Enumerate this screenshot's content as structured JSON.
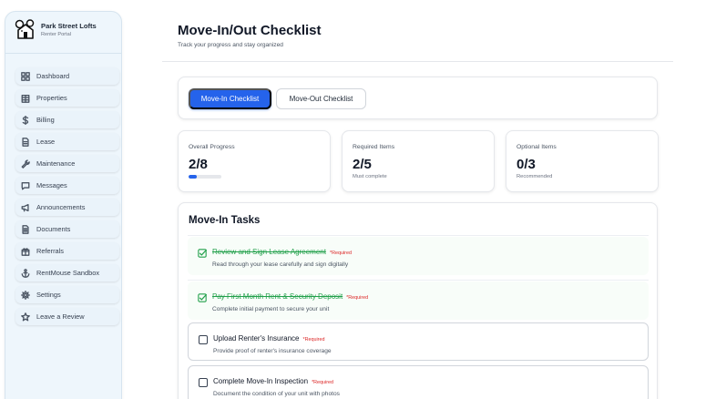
{
  "brand": {
    "name": "Park Street Lofts",
    "subtitle": "Renter Portal"
  },
  "nav": [
    {
      "label": "Dashboard",
      "icon": "dashboard-icon"
    },
    {
      "label": "Properties",
      "icon": "properties-icon"
    },
    {
      "label": "Billing",
      "icon": "dollar-icon"
    },
    {
      "label": "Lease",
      "icon": "document-icon"
    },
    {
      "label": "Maintenance",
      "icon": "wrench-icon"
    },
    {
      "label": "Messages",
      "icon": "chat-icon"
    },
    {
      "label": "Announcements",
      "icon": "megaphone-icon"
    },
    {
      "label": "Documents",
      "icon": "file-icon"
    },
    {
      "label": "Referrals",
      "icon": "gift-icon"
    },
    {
      "label": "RentMouse Sandbox",
      "icon": "anchor-icon"
    },
    {
      "label": "Settings",
      "icon": "gear-icon"
    },
    {
      "label": "Leave a Review",
      "icon": "star-icon"
    }
  ],
  "header": {
    "title": "Move-In/Out Checklist",
    "subtitle": "Track your progress and stay organized"
  },
  "tabs": {
    "move_in": "Move-In Checklist",
    "move_out": "Move-Out Checklist",
    "active": "move_in"
  },
  "stats": {
    "overall": {
      "label": "Overall Progress",
      "value": "2/8",
      "progress": 0.25
    },
    "required": {
      "label": "Required Items",
      "value": "2/5",
      "note": "Must complete"
    },
    "optional": {
      "label": "Optional Items",
      "value": "0/3",
      "note": "Recommended"
    }
  },
  "tasks": {
    "title": "Move-In Tasks",
    "items": [
      {
        "title": "Review and Sign Lease Agreement",
        "required": "*Required",
        "description": "Read through your lease carefully and sign digitally",
        "done": true
      },
      {
        "title": "Pay First Month Rent & Security Deposit",
        "required": "*Required",
        "description": "Complete initial payment to secure your unit",
        "done": true
      },
      {
        "title": "Upload Renter's Insurance",
        "required": "*Required",
        "description": "Provide proof of renter's insurance coverage",
        "done": false
      },
      {
        "title": "Complete Move-In Inspection",
        "required": "*Required",
        "description": "Document the condition of your unit with photos",
        "done": false
      }
    ]
  },
  "colors": {
    "accent": "#2563eb",
    "done": "#22a04b",
    "required": "#dc2626",
    "sidebar": "#eef6fc"
  }
}
